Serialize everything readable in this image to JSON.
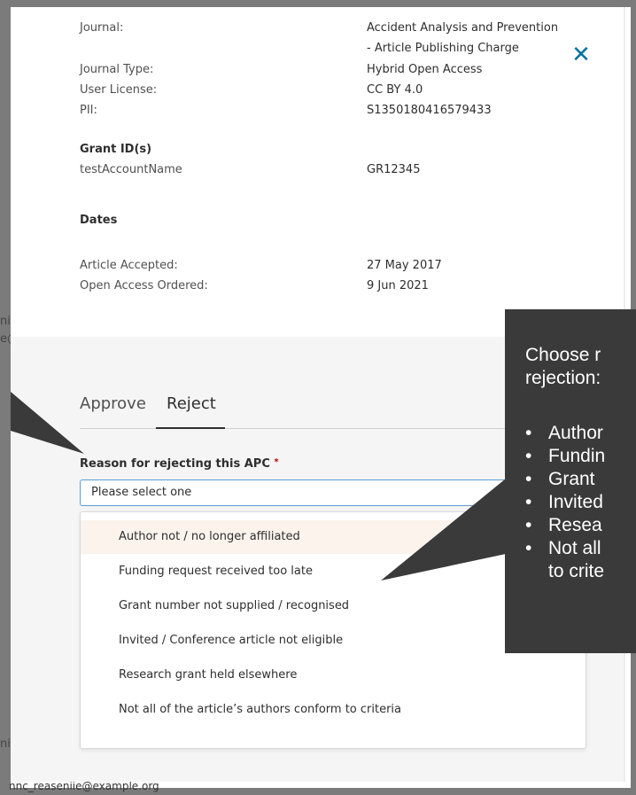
{
  "background": {
    "side_text_1": "ni",
    "side_text_2": "e@",
    "side_text_3": "ni",
    "footer_email": "nnc_reaseniie@example.org"
  },
  "modal": {
    "close_icon": "close-icon",
    "details": [
      {
        "label": "Journal:",
        "value_line1": "Accident Analysis and Prevention",
        "value_line2": "- Article Publishing Charge"
      },
      {
        "label": "Journal Type:",
        "value": "Hybrid Open Access"
      },
      {
        "label": "User License:",
        "value": "CC BY 4.0"
      },
      {
        "label": "PII:",
        "value": "S1350180416579433"
      }
    ],
    "grant_heading": "Grant ID(s)",
    "grant_account": "testAccountName",
    "grant_id": "GR12345",
    "dates_heading": "Dates",
    "dates": [
      {
        "label": "Article Accepted:",
        "value": "27 May 2017"
      },
      {
        "label": "Open Access Ordered:",
        "value": "9 Jun 2021"
      }
    ],
    "tabs": [
      {
        "label": "Approve",
        "active": false
      },
      {
        "label": "Reject",
        "active": true
      }
    ],
    "reject_field_label": "Reason for rejecting this APC",
    "required_marker": "*",
    "select_placeholder": "Please select one",
    "options": [
      "Author not / no longer affiliated",
      "Funding request received too late",
      "Grant number not supplied / recognised",
      "Invited / Conference article not eligible",
      "Research grant held elsewhere",
      "Not all of the article’s authors conform to criteria"
    ]
  },
  "tooltip": {
    "line1": "Choose r",
    "line2": "rejection:",
    "bullet": "•",
    "items": [
      "Author",
      "Fundin",
      "Grant",
      "Invited",
      "Resea",
      "Not all",
      "to crite"
    ]
  },
  "colors": {
    "accent": "#00739e",
    "tooltip_bg": "#3a3a3a",
    "select_border": "#5a9bd5",
    "highlight_option": "#fbf3ec",
    "frame": "#7b7b7b"
  }
}
